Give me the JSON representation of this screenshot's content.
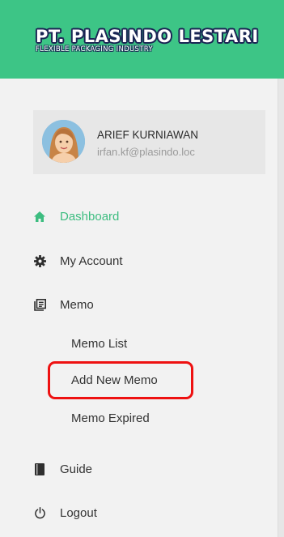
{
  "header": {
    "company_name": "PT. PLASINDO LESTARI",
    "tagline": "FLEXIBLE PACKAGING INDUSTRY",
    "brand_color": "#3dc586"
  },
  "user": {
    "name": "ARIEF KURNIAWAN",
    "email": "irfan.kf@plasindo.loc",
    "avatar_icon": "female-avatar"
  },
  "nav": {
    "dashboard": {
      "label": "Dashboard",
      "icon": "home-icon",
      "active": true
    },
    "my_account": {
      "label": "My Account",
      "icon": "gear-icon"
    },
    "memo": {
      "label": "Memo",
      "icon": "memo-icon",
      "children": {
        "list": {
          "label": "Memo List"
        },
        "add_new": {
          "label": "Add New Memo",
          "highlighted": true
        },
        "expired": {
          "label": "Memo Expired"
        }
      }
    },
    "guide": {
      "label": "Guide",
      "icon": "book-icon"
    },
    "logout": {
      "label": "Logout",
      "icon": "power-icon"
    }
  },
  "colors": {
    "active": "#3dbd80",
    "highlight": "#ee1111",
    "text": "#333333"
  }
}
